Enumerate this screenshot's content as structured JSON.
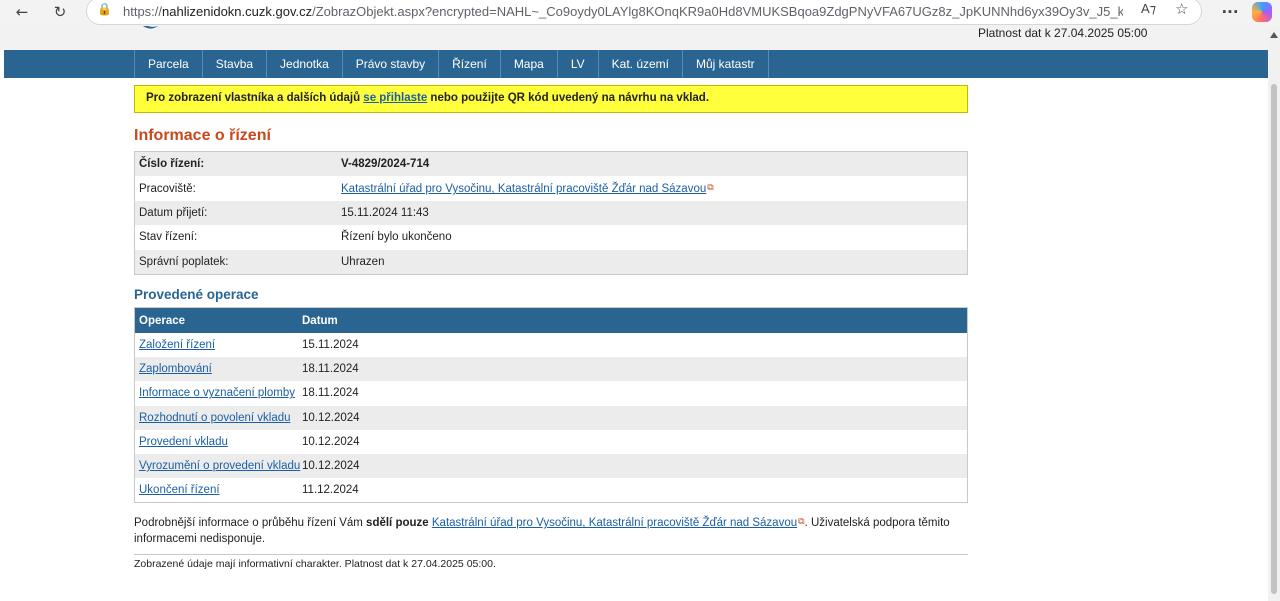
{
  "browser": {
    "url_domain": "nahlizenidokn.cuzk.gov.cz",
    "url_prefix": "https://",
    "url_rest": "/ZobrazObjekt.aspx?encrypted=NAHL~_Co9oydy0LAYlg8KOnqKR9a0Hd8VMUKSBqoa9ZdgPNyVFA67UGz8z_JpKUNNhd6yx39Oy3v_J5_kYWdS1Uv73g4Ycy7_fAG..."
  },
  "header": {
    "validity": "Platnost dat k 27.04.2025 05:00"
  },
  "nav": {
    "items": [
      "Parcela",
      "Stavba",
      "Jednotka",
      "Právo stavby",
      "Řízení",
      "Mapa",
      "LV",
      "Kat. území",
      "Můj katastr"
    ]
  },
  "notice": {
    "before": "Pro zobrazení vlastníka a dalších údajů ",
    "link": "se přihlaste",
    "after": " nebo použijte QR kód uvedený na návrhu na vklad."
  },
  "info": {
    "title": "Informace o řízení",
    "rows": [
      {
        "label": "Číslo řízení:",
        "value": "V-4829/2024-714"
      },
      {
        "label": "Pracoviště:",
        "value": "Katastrální úřad pro Vysočinu, Katastrální pracoviště Žďár nad Sázavou"
      },
      {
        "label": "Datum přijetí:",
        "value": "15.11.2024 11:43"
      },
      {
        "label": "Stav řízení:",
        "value": "Řízení bylo ukončeno"
      },
      {
        "label": "Správní poplatek:",
        "value": "Uhrazen"
      }
    ]
  },
  "operations": {
    "title": "Provedené operace",
    "headers": [
      "Operace",
      "Datum"
    ],
    "rows": [
      {
        "op": "Založení řízení",
        "date": "15.11.2024"
      },
      {
        "op": "Zaplombování",
        "date": "18.11.2024"
      },
      {
        "op": "Informace o vyznačení plomby",
        "date": "18.11.2024"
      },
      {
        "op": "Rozhodnutí o povolení vkladu",
        "date": "10.12.2024"
      },
      {
        "op": "Provedení vkladu",
        "date": "10.12.2024"
      },
      {
        "op": "Vyrozumění o provedení vkladu",
        "date": "10.12.2024"
      },
      {
        "op": "Ukončení řízení",
        "date": "11.12.2024"
      }
    ]
  },
  "footer": {
    "part1": "Podrobnější informace o průběhu řízení Vám ",
    "bold": "sdělí pouze",
    "link": "Katastrální úřad pro Vysočinu, Katastrální pracoviště Žďár nad Sázavou",
    "part2": ". Uživatelská podpora těmito informacemi nedisponuje.",
    "note": "Zobrazené údaje mají informativní charakter. Platnost dat k 27.04.2025 05:00."
  }
}
